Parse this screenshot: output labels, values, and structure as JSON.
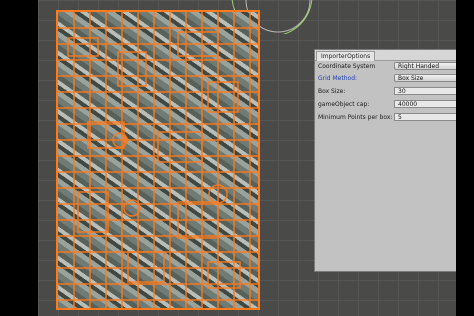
{
  "panel": {
    "tab_title": "ImporterOptions",
    "fields": [
      {
        "label": "Coordinate System",
        "value": "Right Handed",
        "type": "dropdown",
        "highlight": false
      },
      {
        "label": "Grid Method:",
        "value": "Box Size",
        "type": "dropdown",
        "highlight": true
      },
      {
        "label": "Box Size:",
        "value": "30",
        "type": "number"
      },
      {
        "label": "gameObject cap:",
        "value": "40000",
        "type": "number"
      },
      {
        "label": "Minimum Points per box:",
        "value": "5",
        "type": "number"
      }
    ]
  },
  "colors": {
    "overlay_accent": "#ff7a1a",
    "panel_bg": "#c2c2c2",
    "highlight_label": "#1f3fb0",
    "viewport_bg": "#4a4a48"
  },
  "icons": {
    "menu": "menu-icon",
    "close": "close-icon"
  }
}
